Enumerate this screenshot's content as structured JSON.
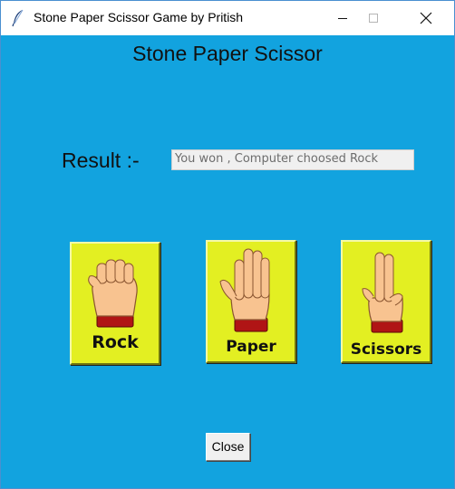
{
  "window": {
    "title": "Stone Paper Scissor Game by Pritish",
    "icon": "feather-icon",
    "controls": [
      "minimize-icon",
      "maximize-icon",
      "close-icon"
    ]
  },
  "app": {
    "heading": "Stone Paper Scissor",
    "result_label": "Result :-",
    "result_value": "You won , Computer choosed Rock",
    "background_color": "#12a3df"
  },
  "choices": [
    {
      "label": "Rock",
      "icon": "fist-icon",
      "color": "#e3ef22"
    },
    {
      "label": "Paper",
      "icon": "open-hand-icon",
      "color": "#e3ef22"
    },
    {
      "label": "Scissors",
      "icon": "two-fingers-icon",
      "color": "#e3ef22"
    }
  ],
  "close_button": {
    "label": "Close"
  }
}
